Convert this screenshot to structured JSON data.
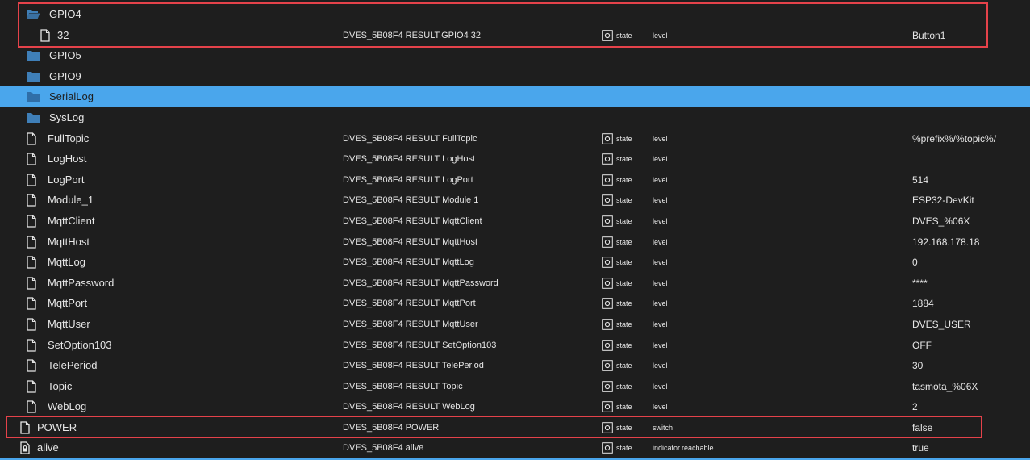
{
  "colors": {
    "background": "#1e1e1e",
    "selection": "#4aa6ec",
    "highlight_border": "#e5424a",
    "folder_icon": "#3f7fb8"
  },
  "rows": [
    {
      "kind": "folder-open",
      "indent": 0,
      "name": "GPIO4",
      "id": "",
      "role_type": "",
      "role": "",
      "value": ""
    },
    {
      "kind": "state",
      "indent": 1,
      "name": "32",
      "id": "DVES_5B08F4 RESULT.GPIO4 32",
      "role_type": "state",
      "role": "level",
      "value": "Button1"
    },
    {
      "kind": "folder",
      "indent": 0,
      "name": "GPIO5",
      "id": "",
      "role_type": "",
      "role": "",
      "value": ""
    },
    {
      "kind": "folder",
      "indent": 0,
      "name": "GPIO9",
      "id": "",
      "role_type": "",
      "role": "",
      "value": ""
    },
    {
      "kind": "folder",
      "indent": 0,
      "name": "SerialLog",
      "id": "",
      "role_type": "",
      "role": "",
      "value": "",
      "selected": true
    },
    {
      "kind": "folder",
      "indent": 0,
      "name": "SysLog",
      "id": "",
      "role_type": "",
      "role": "",
      "value": ""
    },
    {
      "kind": "state",
      "indent": 0,
      "name": "FullTopic",
      "id": "DVES_5B08F4 RESULT FullTopic",
      "role_type": "state",
      "role": "level",
      "value": "%prefix%/%topic%/"
    },
    {
      "kind": "state",
      "indent": 0,
      "name": "LogHost",
      "id": "DVES_5B08F4 RESULT LogHost",
      "role_type": "state",
      "role": "level",
      "value": ""
    },
    {
      "kind": "state",
      "indent": 0,
      "name": "LogPort",
      "id": "DVES_5B08F4 RESULT LogPort",
      "role_type": "state",
      "role": "level",
      "value": "514"
    },
    {
      "kind": "state",
      "indent": 0,
      "name": "Module_1",
      "id": "DVES_5B08F4 RESULT Module 1",
      "role_type": "state",
      "role": "level",
      "value": "ESP32-DevKit"
    },
    {
      "kind": "state",
      "indent": 0,
      "name": "MqttClient",
      "id": "DVES_5B08F4 RESULT MqttClient",
      "role_type": "state",
      "role": "level",
      "value": "DVES_%06X"
    },
    {
      "kind": "state",
      "indent": 0,
      "name": "MqttHost",
      "id": "DVES_5B08F4 RESULT MqttHost",
      "role_type": "state",
      "role": "level",
      "value": "192.168.178.18"
    },
    {
      "kind": "state",
      "indent": 0,
      "name": "MqttLog",
      "id": "DVES_5B08F4 RESULT MqttLog",
      "role_type": "state",
      "role": "level",
      "value": "0"
    },
    {
      "kind": "state",
      "indent": 0,
      "name": "MqttPassword",
      "id": "DVES_5B08F4 RESULT MqttPassword",
      "role_type": "state",
      "role": "level",
      "value": "****"
    },
    {
      "kind": "state",
      "indent": 0,
      "name": "MqttPort",
      "id": "DVES_5B08F4 RESULT MqttPort",
      "role_type": "state",
      "role": "level",
      "value": "1884"
    },
    {
      "kind": "state",
      "indent": 0,
      "name": "MqttUser",
      "id": "DVES_5B08F4 RESULT MqttUser",
      "role_type": "state",
      "role": "level",
      "value": "DVES_USER"
    },
    {
      "kind": "state",
      "indent": 0,
      "name": "SetOption103",
      "id": "DVES_5B08F4 RESULT SetOption103",
      "role_type": "state",
      "role": "level",
      "value": "OFF"
    },
    {
      "kind": "state",
      "indent": 0,
      "name": "TelePeriod",
      "id": "DVES_5B08F4 RESULT TelePeriod",
      "role_type": "state",
      "role": "level",
      "value": "30"
    },
    {
      "kind": "state",
      "indent": 0,
      "name": "Topic",
      "id": "DVES_5B08F4 RESULT Topic",
      "role_type": "state",
      "role": "level",
      "value": "tasmota_%06X"
    },
    {
      "kind": "state",
      "indent": 0,
      "name": "WebLog",
      "id": "DVES_5B08F4 RESULT WebLog",
      "role_type": "state",
      "role": "level",
      "value": "2"
    },
    {
      "kind": "state",
      "indent": -1,
      "name": "POWER",
      "id": "DVES_5B08F4 POWER",
      "role_type": "state",
      "role": "switch",
      "value": "false"
    },
    {
      "kind": "state-locked",
      "indent": -1,
      "name": "alive",
      "id": "DVES_5B08F4 alive",
      "role_type": "state",
      "role": "indicator.reachable",
      "value": "true"
    }
  ]
}
